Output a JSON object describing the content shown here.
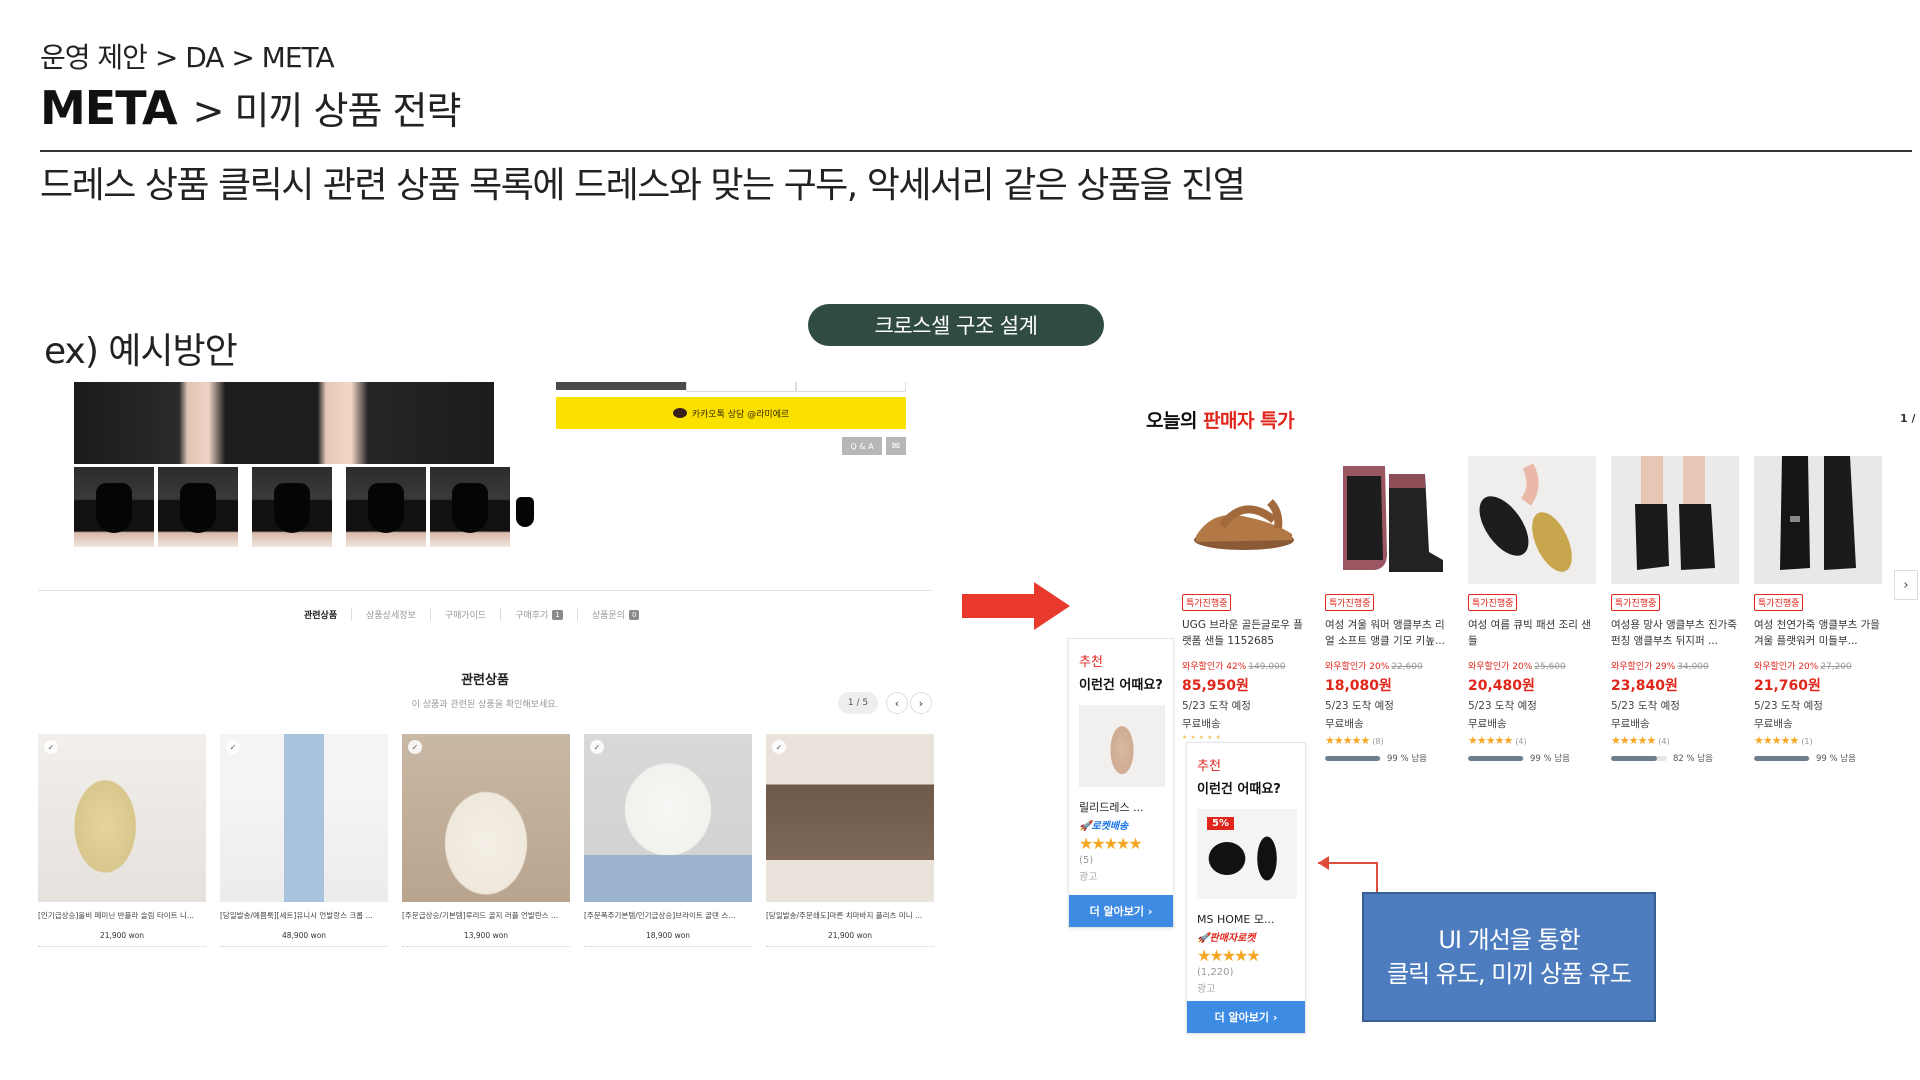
{
  "header": {
    "breadcrumb": "운영 제안 > DA > META",
    "title_main": "META",
    "title_sub": "> 미끼 상품 전략",
    "headline": "드레스 상품 클릭시 관련 상품 목록에 드레스와 맞는 구두, 악세서리 같은 상품을 진열",
    "example_label": "ex) 예시방안",
    "pill": "크로스셀 구조 설계"
  },
  "left_mockup": {
    "kakao_button": "카카오톡 상담 @라미에르",
    "qa_button": "Q & A",
    "tabs": [
      {
        "label": "관련상품",
        "count": ""
      },
      {
        "label": "상품상세정보",
        "count": ""
      },
      {
        "label": "구매가이드",
        "count": ""
      },
      {
        "label": "구매후기",
        "count": "1"
      },
      {
        "label": "상품문의",
        "count": "0"
      }
    ],
    "related_title": "관련상품",
    "related_subtitle": "이 상품과 관련된 상품을 확인해보세요.",
    "pager": "1 / 5",
    "products": [
      {
        "name": "[인기급상승]올비 페미닌 반플라 슬림 타이트 니...",
        "price": "21,900 won"
      },
      {
        "name": "[당일발송/예쁨룩][세트]유니시 언발랑스 크롭 ...",
        "price": "48,900 won"
      },
      {
        "name": "[주문급상승/기본템]루리드 골지 러플 언발란스 ...",
        "price": "13,900 won"
      },
      {
        "name": "[주문폭주기본템/인기급상승]브라이트 골덴 스...",
        "price": "18,900 won"
      },
      {
        "name": "[당일발송/주문쇄도]마른 치마바지 플리츠 미니 ...",
        "price": "21,900 won"
      }
    ]
  },
  "right_mockup": {
    "title_prefix": "오늘의 ",
    "title_highlight": "판매자 특가",
    "page_indicator": "1 /",
    "deals": [
      {
        "badge": "특가진행중",
        "name": "UGG 브라운 골든글로우 플랫폼 샌들 1152685",
        "disc_label": "와우할인가 42%",
        "orig": "149,000",
        "price": "85,950원",
        "eta": "5/23 도착 예정",
        "ship": "무료배송",
        "stars": "★★★★★",
        "reviews": "",
        "stock": "",
        "stock_pct": 0
      },
      {
        "badge": "특가진행중",
        "name": "여성 겨울 워머 앵클부츠 리얼 소프트 앵클 기모 키높...",
        "disc_label": "와우할인가 20%",
        "orig": "22,600",
        "price": "18,080원",
        "eta": "5/23 도착 예정",
        "ship": "무료배송",
        "stars": "★★★★★",
        "reviews": "(8)",
        "stock": "99 % 남음",
        "stock_pct": 99
      },
      {
        "badge": "특가진행중",
        "name": "여성 여름 큐빅 패션 조리 샌들",
        "disc_label": "와우할인가 20%",
        "orig": "25,600",
        "price": "20,480원",
        "eta": "5/23 도착 예정",
        "ship": "무료배송",
        "stars": "★★★★★",
        "reviews": "(4)",
        "stock": "99 % 남음",
        "stock_pct": 99
      },
      {
        "badge": "특가진행중",
        "name": "여성용 망사 앵클부츠 진가죽 펀칭 앵클부츠 뒤지퍼 ...",
        "disc_label": "와우할인가 29%",
        "orig": "34,000",
        "price": "23,840원",
        "eta": "5/23 도착 예정",
        "ship": "무료배송",
        "stars": "★★★★★",
        "reviews": "(4)",
        "stock": "82 % 남음",
        "stock_pct": 82
      },
      {
        "badge": "특가진행중",
        "name": "여성 천연가죽 앵클부츠 가을겨울 플랫워커 미들부...",
        "disc_label": "와우할인가 20%",
        "orig": "27,200",
        "price": "21,760원",
        "eta": "5/23 도착 예정",
        "ship": "무료배송",
        "stars": "★★★★★",
        "reviews": "(1)",
        "stock": "99 % 남음",
        "stock_pct": 99
      }
    ],
    "ad1": {
      "rec": "추천",
      "question": "이런건 어때요?",
      "name": "릴리드레스 ...",
      "rocket": "로켓배송",
      "stars": "★★★★★",
      "reviews": "(5)",
      "ad_label": "광고",
      "more": "더 알아보기"
    },
    "ad2": {
      "rec": "추천",
      "question": "이런건 어때요?",
      "percent": "5%",
      "name": "MS HOME 모...",
      "rocket": "판매자로켓",
      "stars": "★★★★★",
      "reviews": "(1,220)",
      "ad_label": "광고",
      "more": "더 알아보기"
    }
  },
  "callout": {
    "line1": "UI 개선을 통한",
    "line2": "클릭 유도, 미끼 상품 유도"
  },
  "colors": {
    "pill_bg": "#2f4b43",
    "sale_red": "#e0261b",
    "kakao_yellow": "#fae100",
    "callout_blue": "#4d7dbf",
    "cta_blue": "#3d8be3",
    "arrow_red": "#e8392c"
  }
}
